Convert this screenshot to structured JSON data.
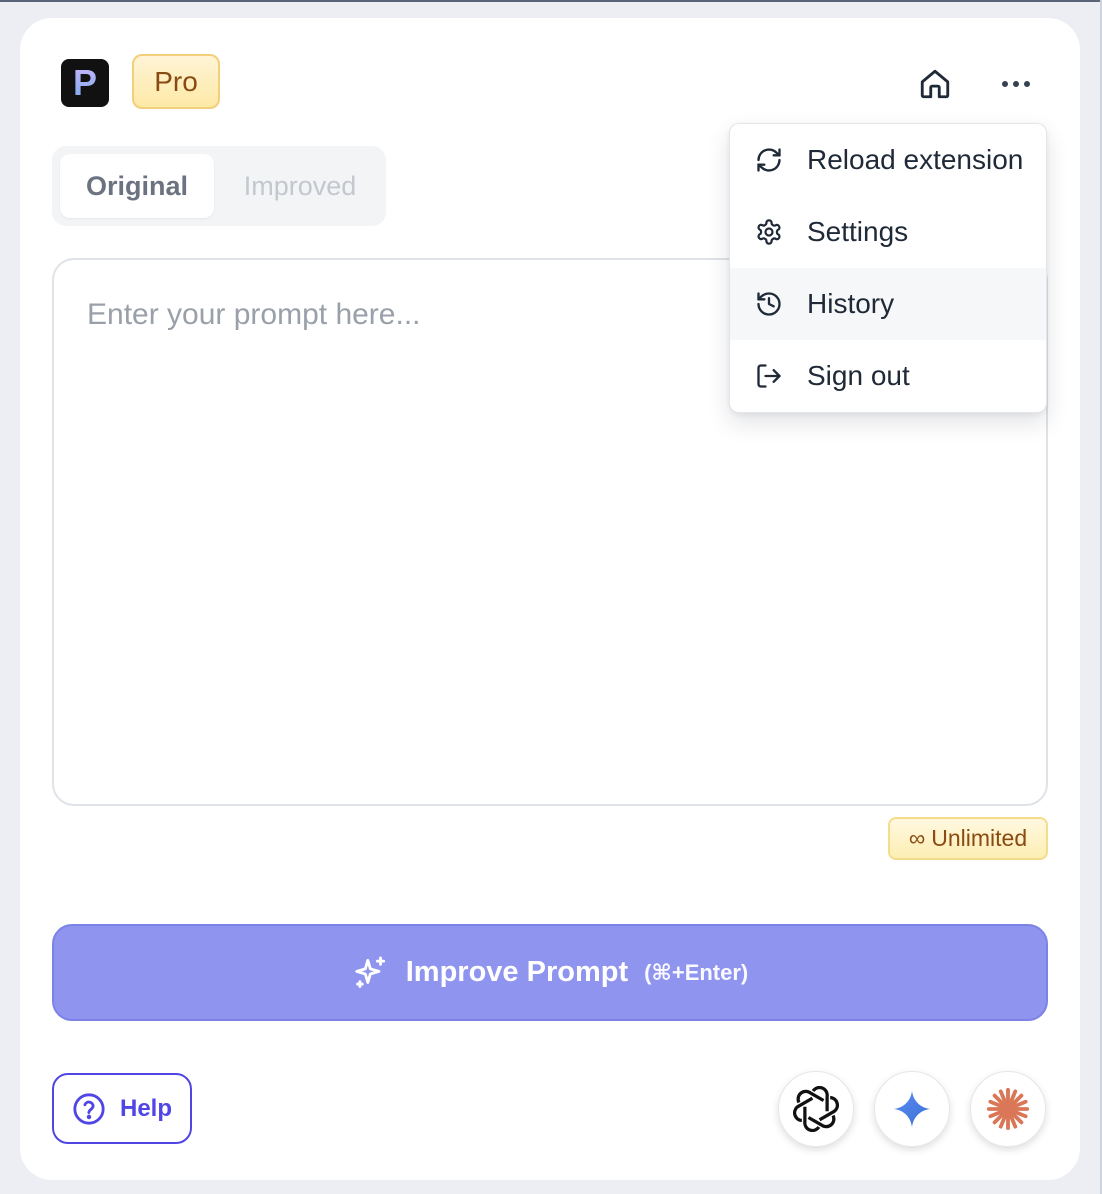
{
  "header": {
    "logo_letter": "P",
    "plan_badge": "Pro"
  },
  "tabs": [
    {
      "label": "Original",
      "active": true
    },
    {
      "label": "Improved",
      "active": false
    }
  ],
  "prompt": {
    "placeholder": "Enter your prompt here...",
    "value": ""
  },
  "usage_badge": {
    "symbol": "∞",
    "label": "Unlimited"
  },
  "improve_button": {
    "label": "Improve Prompt",
    "shortcut": "(⌘+Enter)"
  },
  "help_button": {
    "label": "Help"
  },
  "llm_buttons": [
    {
      "name": "ChatGPT",
      "icon": "openai-icon"
    },
    {
      "name": "Gemini",
      "icon": "gemini-icon"
    },
    {
      "name": "Claude",
      "icon": "claude-icon"
    }
  ],
  "menu": {
    "open": true,
    "items": [
      {
        "label": "Reload extension",
        "icon": "reload-icon"
      },
      {
        "label": "Settings",
        "icon": "gear-icon"
      },
      {
        "label": "History",
        "icon": "history-icon",
        "highlighted": true
      },
      {
        "label": "Sign out",
        "icon": "sign-out-icon"
      }
    ]
  },
  "colors": {
    "accent": "#4f46e5",
    "improve_button_bg": "#8f94ef",
    "badge_bg": "#fde9a6",
    "badge_text": "#8a4b12",
    "gemini_blue": "#4a86e8",
    "claude_orange": "#d97757"
  }
}
